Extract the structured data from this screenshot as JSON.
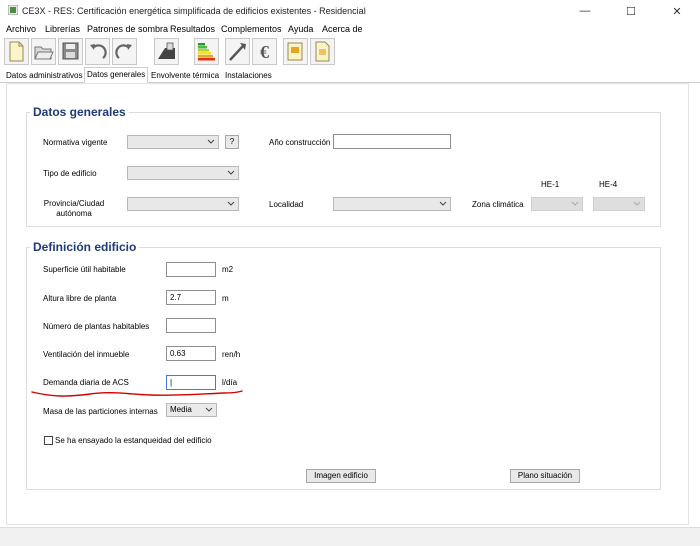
{
  "window": {
    "app_name": "CE3X",
    "separator": "-",
    "title": "RES: Certificación energética simplificada de edificios existentes - Residencial",
    "minimize": "—",
    "maximize": "☐",
    "close": "✕"
  },
  "menu": [
    "Archivo",
    "Librerías",
    "Patrones de sombra",
    "Resultados",
    "Complementos",
    "Ayuda",
    "Acerca de"
  ],
  "toolbar": [
    "new-file",
    "open-folder",
    "save",
    "undo",
    "redo",
    "print",
    "energy-rating",
    "improvement-measures",
    "economic-analysis",
    "report"
  ],
  "tabs": {
    "t1": "Datos administrativos",
    "t2": "Datos generales",
    "t3": "Envolvente térmica",
    "t4": "Instalaciones",
    "active": "Datos generales"
  },
  "datos_generales": {
    "title": "Datos generales",
    "normativa_label": "Normativa vigente",
    "normativa_value": "",
    "help_label": "?",
    "anio_label": "Año construcción",
    "anio_value": "",
    "tipo_label": "Tipo de edificio",
    "tipo_value": "",
    "provincia_label": "Provincia/Ciudad autónoma",
    "provincia_value": "",
    "localidad_label": "Localidad",
    "localidad_value": "",
    "zona_label": "Zona climática",
    "he1_label": "HE-1",
    "he4_label": "HE-4"
  },
  "definicion": {
    "title": "Definición edificio",
    "superficie_label": "Superficie útil habitable",
    "superficie_value": "",
    "superficie_unit": "m2",
    "altura_label": "Altura libre de planta",
    "altura_value": "2.7",
    "altura_unit": "m",
    "plantas_label": "Número de plantas habitables",
    "plantas_value": "",
    "ventilacion_label": "Ventilación del inmueble",
    "ventilacion_value": "0.63",
    "ventilacion_unit": "ren/h",
    "acs_label": "Demanda diaria de ACS",
    "acs_value": "|",
    "acs_unit": "l/día",
    "masa_label": "Masa de las particiones internas",
    "masa_value": "Media",
    "estanqueidad_label": "Se ha ensayado la estanqueidad del edificio",
    "estanqueidad_checked": false,
    "imagen_button": "Imagen edificio",
    "plano_button": "Plano situación"
  },
  "colors": {
    "section_title": "#1f3a7a",
    "annotation": "#d40000",
    "focus": "#3c7fd0"
  }
}
